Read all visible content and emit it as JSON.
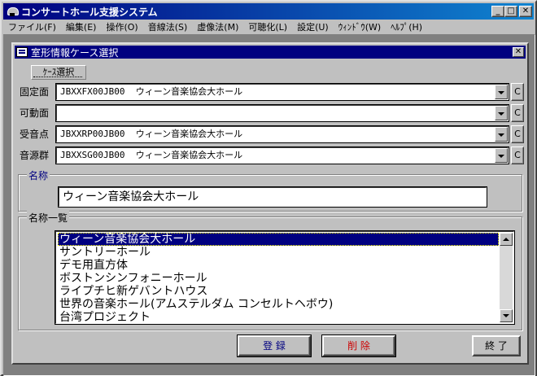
{
  "app": {
    "title": "コンサートホール支援システム",
    "window_buttons": {
      "minimize": "_",
      "maximize": "□",
      "close": "✕"
    }
  },
  "menu": [
    "ファイル(F)",
    "編集(E)",
    "操作(O)",
    "音線法(S)",
    "虚像法(M)",
    "可聴化(L)",
    "設定(U)",
    "ｳｨﾝﾄﾞｳ(W)",
    "ﾍﾙﾌﾟ(H)"
  ],
  "dialog": {
    "title": "室形情報ケース選択",
    "close": "✕",
    "case_label": "ｹｰｽ選択",
    "rows": [
      {
        "label": "固定面",
        "code": "JBXXFX00JB00",
        "value": "ウィーン音楽協会大ホール",
        "button": "C"
      },
      {
        "label": "可動面",
        "code": "",
        "value": "",
        "button": "C"
      },
      {
        "label": "受音点",
        "code": "JBXXRP00JB00",
        "value": "ウィーン音楽協会大ホール",
        "button": "C"
      },
      {
        "label": "音源群",
        "code": "JBXXSG00JB00",
        "value": "ウィーン音楽協会大ホール",
        "button": "C"
      }
    ],
    "name_caption": "名称",
    "name_value": "ウィーン音楽協会大ホール",
    "list_caption": "名称一覧",
    "list_items": [
      "ウィーン音楽協会大ホール",
      "サントリーホール",
      "デモ用直方体",
      "ボストンシンフォニーホール",
      "ライプチヒ新ゲバントハウス",
      "世界の音楽ホール(アムステルダム コンセルトヘボウ)",
      "台湾プロジェクト"
    ],
    "selected_index": 0,
    "buttons": {
      "register": "登 録",
      "delete": "削 除",
      "exit": "終 了"
    }
  }
}
